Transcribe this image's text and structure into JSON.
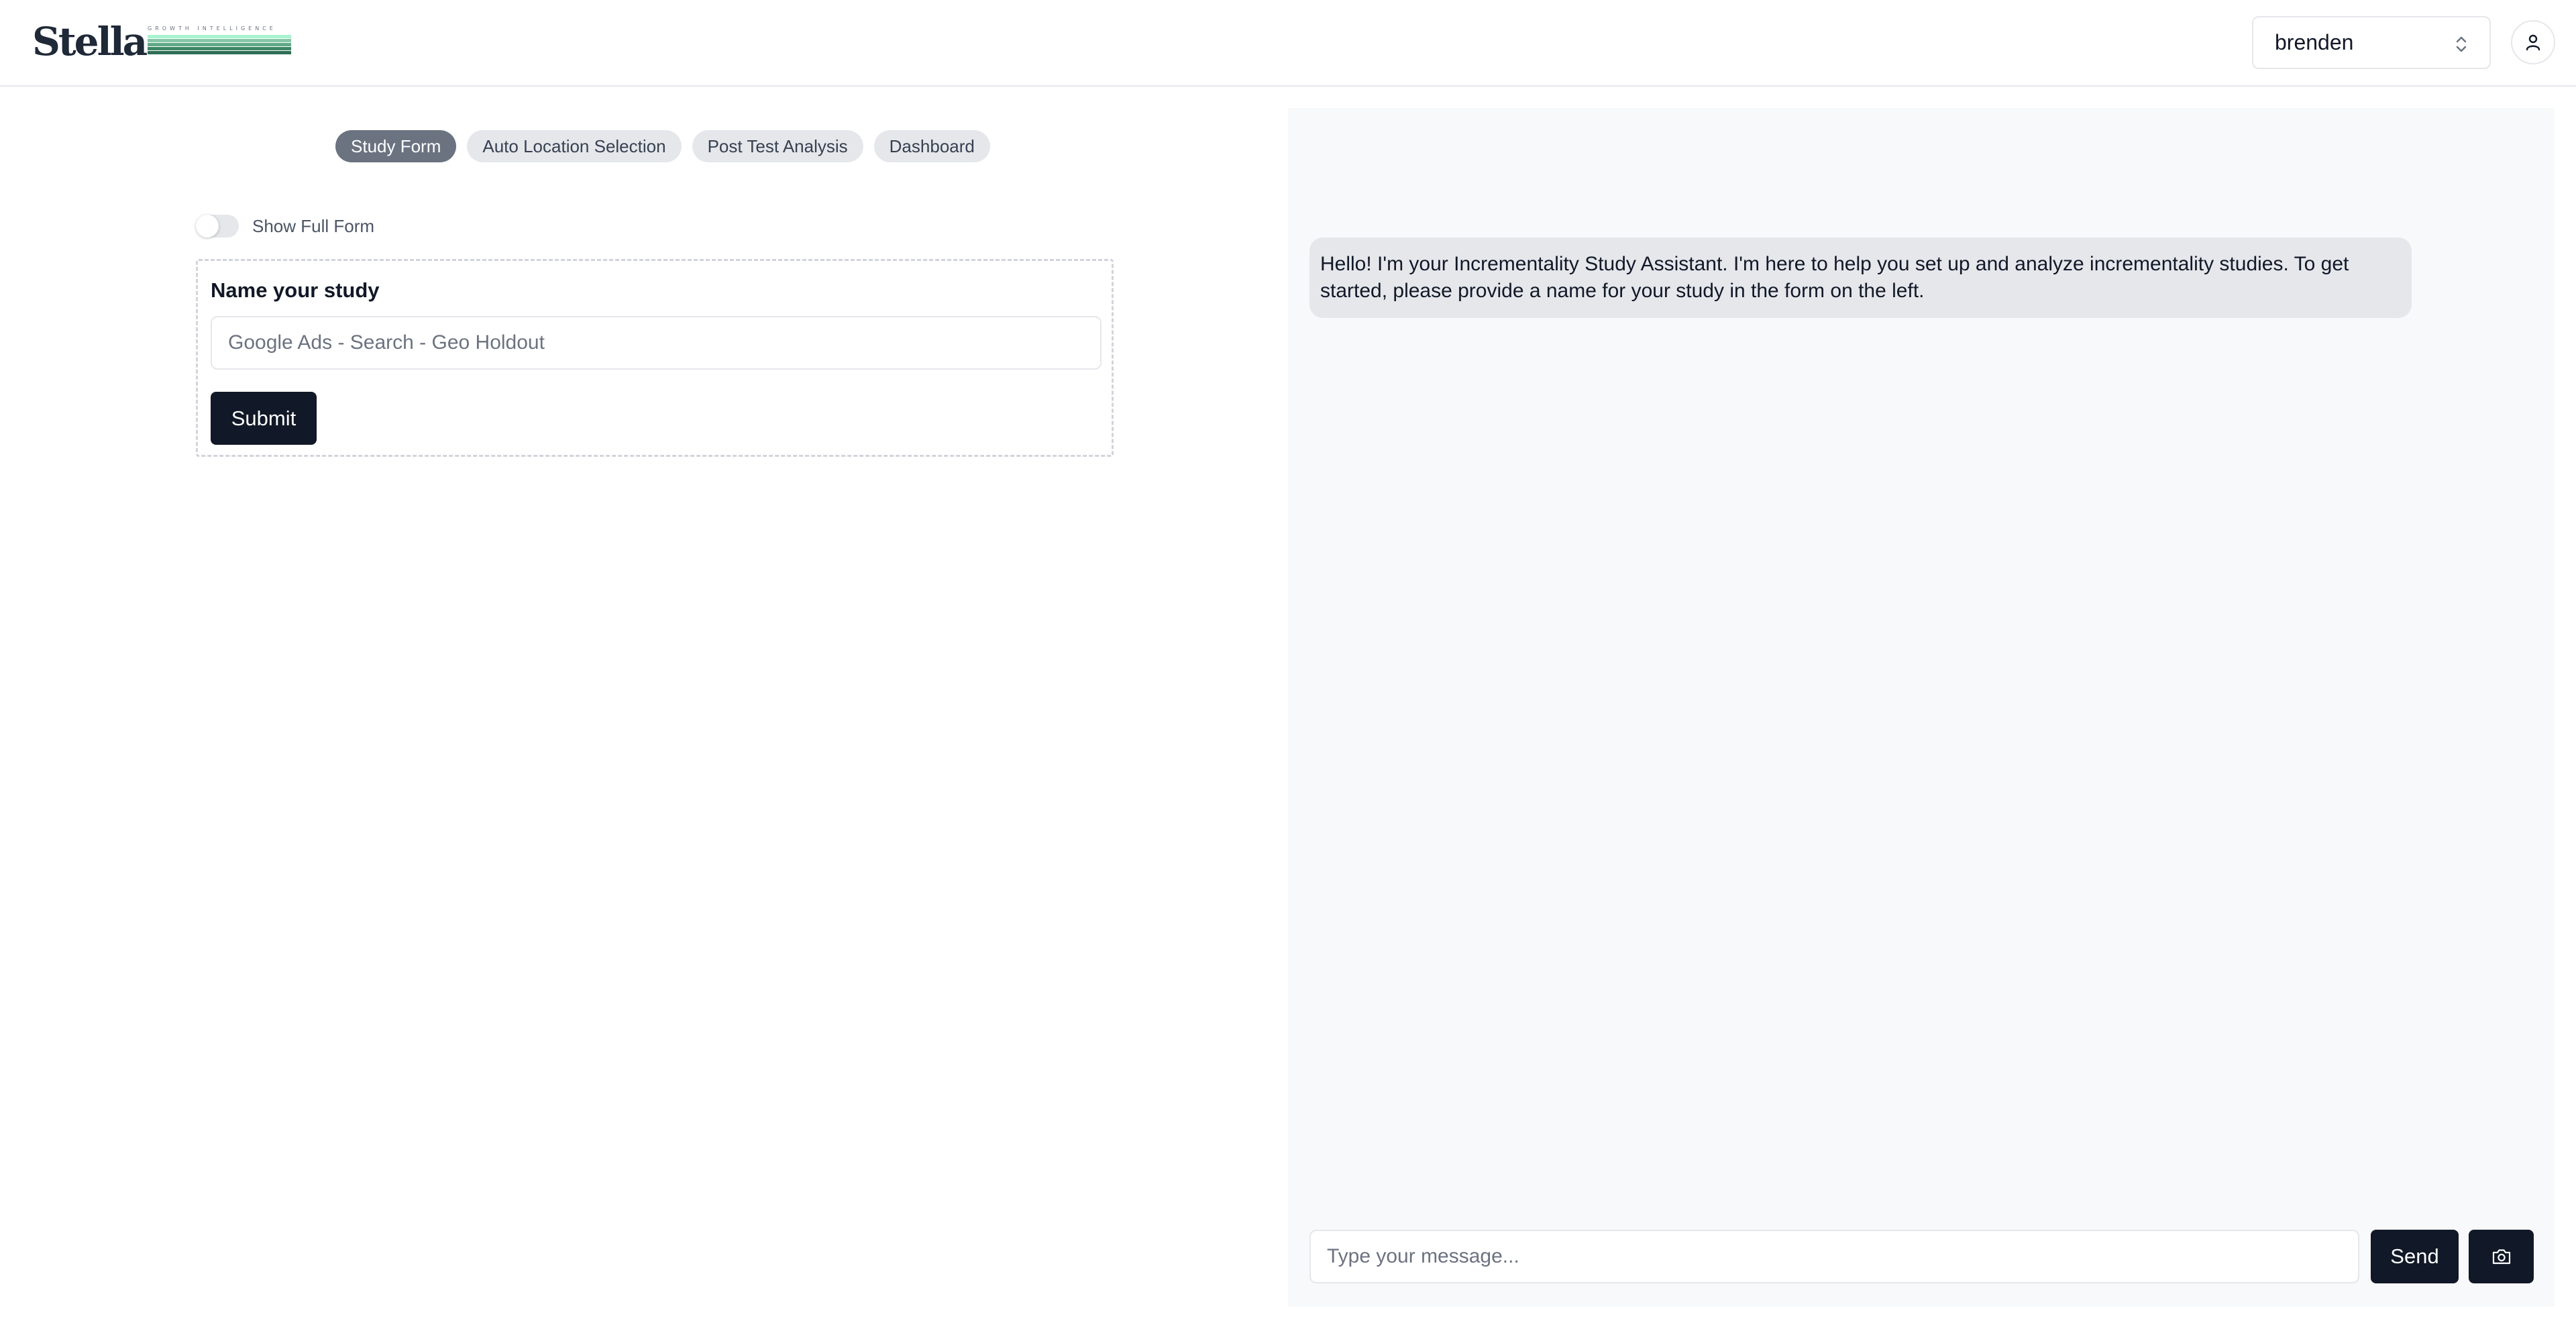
{
  "header": {
    "logo": {
      "wordmark": "Stella",
      "tagline": "GROWTH INTELLIGENCE"
    },
    "user_select": {
      "value": "brenden"
    },
    "icons": {
      "chevron": "chevron-up-down-icon",
      "profile": "user-icon"
    }
  },
  "left": {
    "tabs": [
      {
        "label": "Study Form",
        "active": true
      },
      {
        "label": "Auto Location Selection",
        "active": false
      },
      {
        "label": "Post Test Analysis",
        "active": false
      },
      {
        "label": "Dashboard",
        "active": false
      }
    ],
    "toggle": {
      "label": "Show Full Form",
      "on": false
    },
    "form": {
      "label": "Name your study",
      "placeholder": "Google Ads - Search - Geo Holdout",
      "value": "",
      "submit_label": "Submit"
    }
  },
  "chat": {
    "messages": [
      {
        "role": "assistant",
        "text": "Hello! I'm your Incrementality Study Assistant. I'm here to help you set up and analyze incrementality studies. To get started, please provide a name for your study in the form on the left."
      }
    ],
    "input_placeholder": "Type your message...",
    "send_label": "Send",
    "camera_icon": "camera-icon"
  },
  "colors": {
    "primary_button": "#111827",
    "active_tab": "#6b7280",
    "tab_bg": "#e5e7eb",
    "chat_bg": "#f8f9fa",
    "bubble_bg": "#e5e7eb",
    "logo_stripes": [
      "#9ca3af",
      "#86c5a6",
      "#4d9a76",
      "#2f6e55"
    ]
  }
}
